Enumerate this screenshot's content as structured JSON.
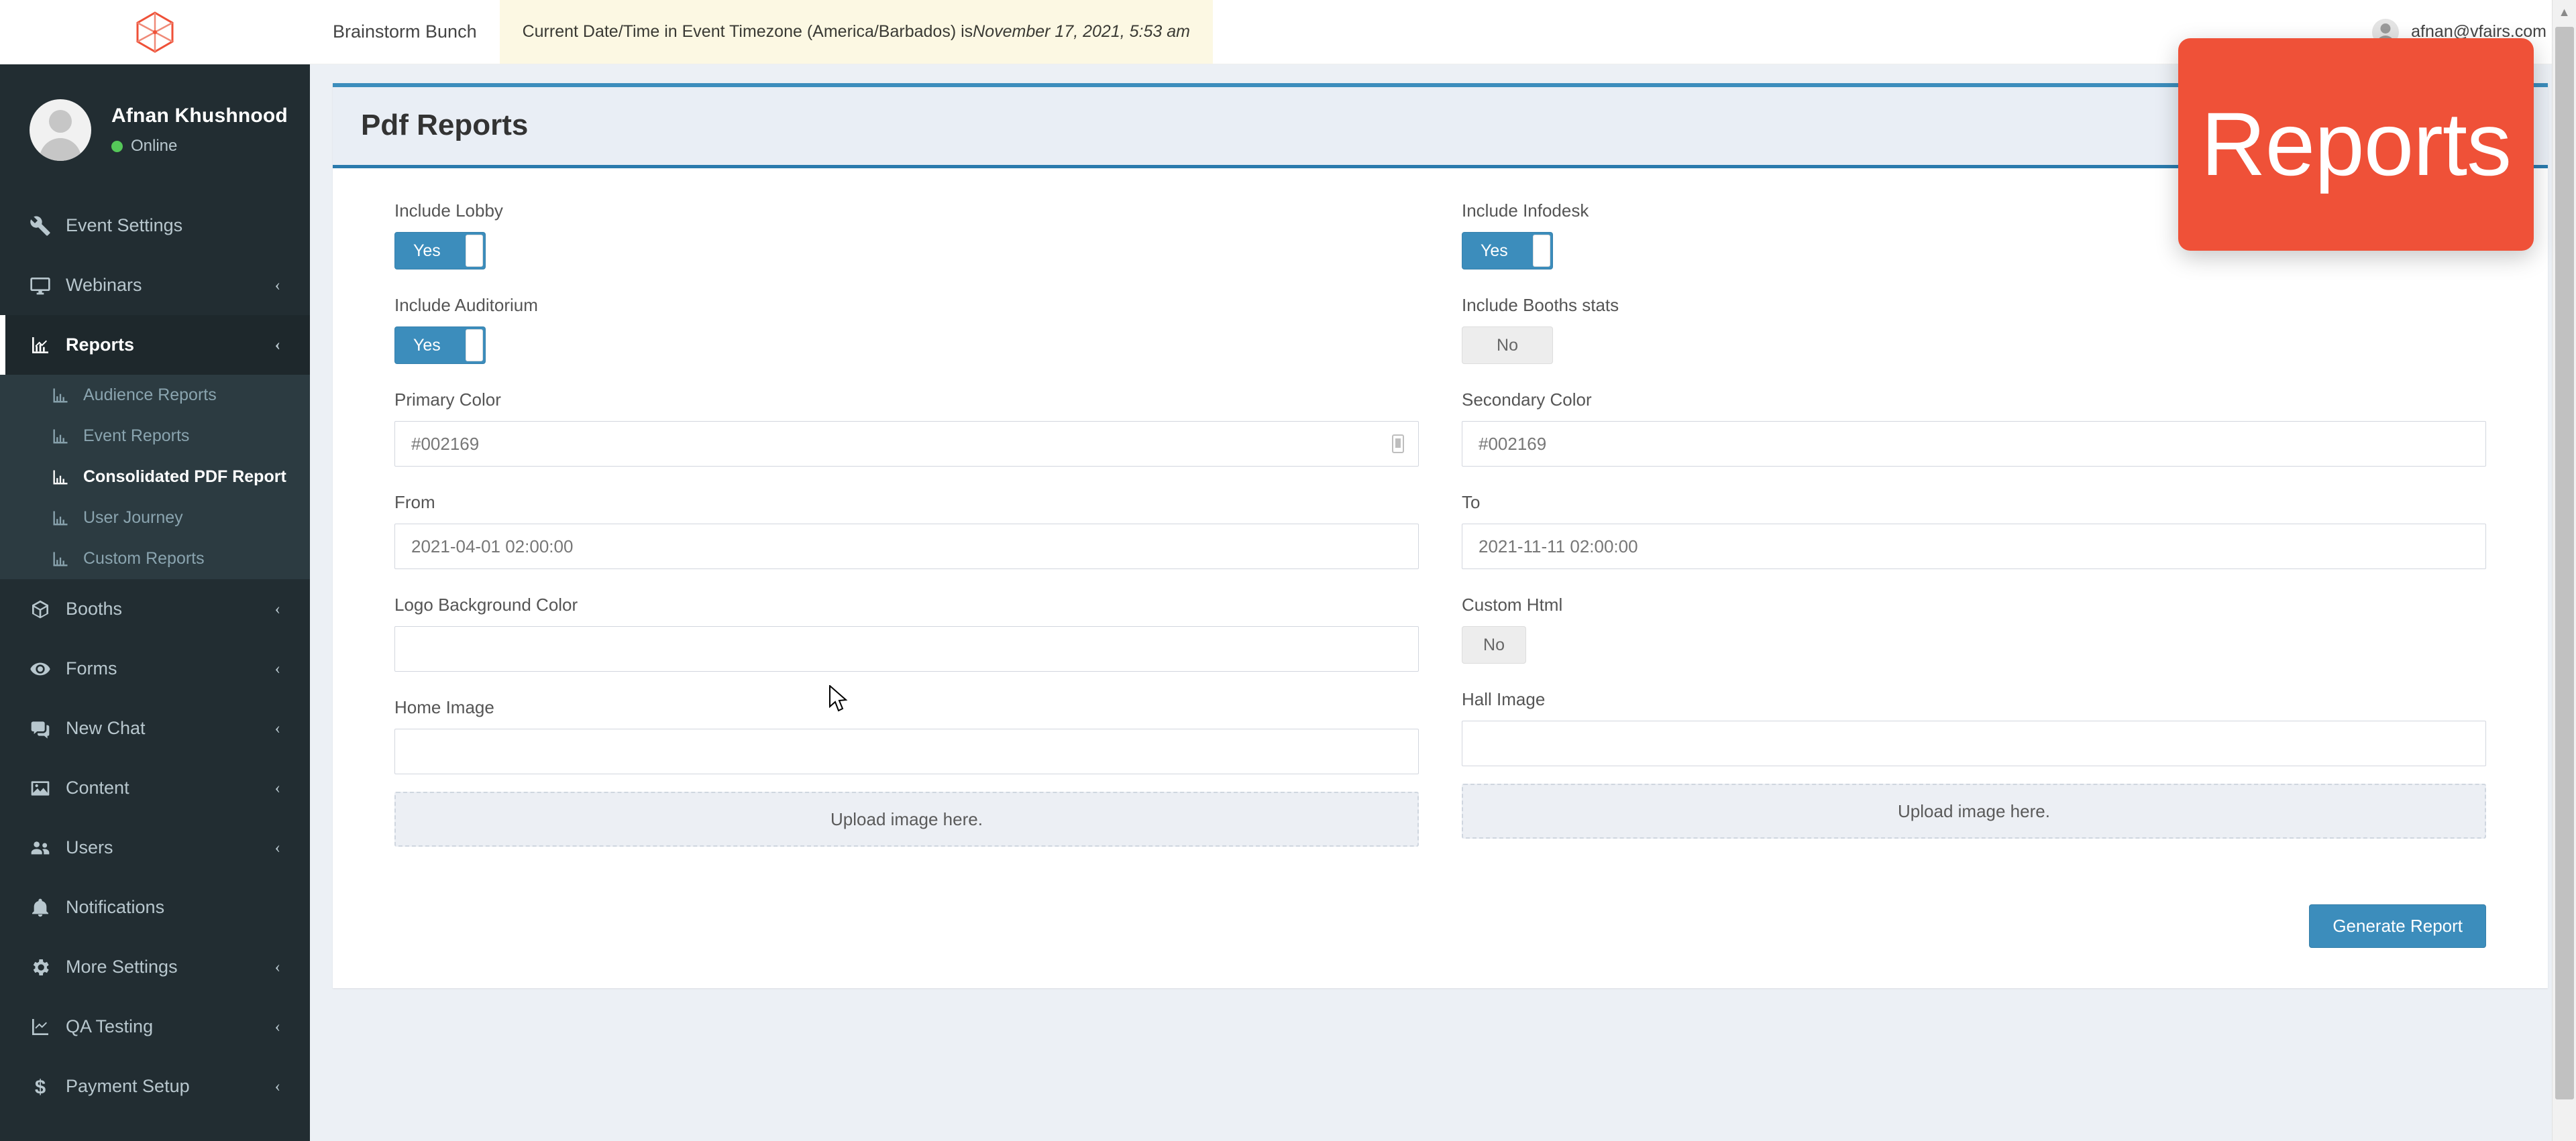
{
  "sidebar": {
    "brand_icon": "hexagon-cube-logo",
    "profile": {
      "name": "Afnan Khushnood",
      "status": "Online",
      "avatar_icon": "avatar-placeholder-icon"
    },
    "items": [
      {
        "label": "Event Settings",
        "icon": "wrench-icon",
        "chevron": "",
        "active": false
      },
      {
        "label": "Webinars",
        "icon": "monitor-icon",
        "chevron": "‹",
        "active": false
      },
      {
        "label": "Reports",
        "icon": "chart-line-icon",
        "chevron": "‹",
        "active": true
      },
      {
        "label": "Booths",
        "icon": "box-icon",
        "chevron": "‹",
        "active": false
      },
      {
        "label": "Forms",
        "icon": "eye-icon",
        "chevron": "‹",
        "active": false
      },
      {
        "label": "New Chat",
        "icon": "chat-bubbles-icon",
        "chevron": "‹",
        "active": false
      },
      {
        "label": "Content",
        "icon": "image-icon",
        "chevron": "‹",
        "active": false
      },
      {
        "label": "Users",
        "icon": "users-icon",
        "chevron": "‹",
        "active": false
      },
      {
        "label": "Notifications",
        "icon": "bell-icon",
        "chevron": "",
        "active": false
      },
      {
        "label": "More Settings",
        "icon": "gear-icon",
        "chevron": "‹",
        "active": false
      },
      {
        "label": "QA Testing",
        "icon": "chart-line-icon",
        "chevron": "‹",
        "active": false
      },
      {
        "label": "Payment Setup",
        "icon": "dollar-icon",
        "chevron": "‹",
        "active": false
      }
    ],
    "reports_submenu": [
      {
        "label": "Audience Reports",
        "icon": "chart-line-icon",
        "active": false
      },
      {
        "label": "Event Reports",
        "icon": "chart-line-icon",
        "active": false
      },
      {
        "label": "Consolidated PDF Report",
        "icon": "chart-line-icon",
        "active": true
      },
      {
        "label": "User Journey",
        "icon": "chart-line-icon",
        "active": false
      },
      {
        "label": "Custom Reports",
        "icon": "chart-line-icon",
        "active": false
      }
    ]
  },
  "topbar": {
    "event_name": "Brainstorm Bunch",
    "timezone_prefix": "Current Date/Time in Event Timezone (America/Barbados) is ",
    "timezone_datetime": "November 17, 2021, 5:53 am",
    "user_email": "afnan@vfairs.com",
    "user_icon": "user-avatar-icon"
  },
  "page": {
    "title": "Pdf Reports"
  },
  "form": {
    "include_lobby": {
      "label": "Include Lobby",
      "value": "Yes",
      "on": true
    },
    "include_infodesk": {
      "label": "Include Infodesk",
      "value": "Yes",
      "on": true
    },
    "include_auditorium": {
      "label": "Include Auditorium",
      "value": "Yes",
      "on": true
    },
    "include_booths_stats": {
      "label": "Include Booths stats",
      "value": "No",
      "on": false
    },
    "primary_color": {
      "label": "Primary Color",
      "value": "#002169",
      "picker_icon": "eyedropper-icon"
    },
    "secondary_color": {
      "label": "Secondary Color",
      "value": "#002169"
    },
    "from": {
      "label": "From",
      "value": "2021-04-01 02:00:00"
    },
    "to": {
      "label": "To",
      "value": "2021-11-11 02:00:00"
    },
    "logo_background_color": {
      "label": "Logo Background Color",
      "value": ""
    },
    "custom_html": {
      "label": "Custom Html",
      "value": "No",
      "on": false
    },
    "home_image": {
      "label": "Home Image",
      "value": "",
      "dropzone": "Upload image here."
    },
    "hall_image": {
      "label": "Hall Image",
      "value": "",
      "dropzone": "Upload image here."
    },
    "generate_button": "Generate Report"
  },
  "overlay": {
    "badge_text": "Reports",
    "badge_color": "#ef5138"
  },
  "colors": {
    "accent": "#3c8dbc",
    "sidebar_bg": "#222d32",
    "content_bg": "#ecf0f5",
    "banner_bg": "#fcf8e3"
  }
}
